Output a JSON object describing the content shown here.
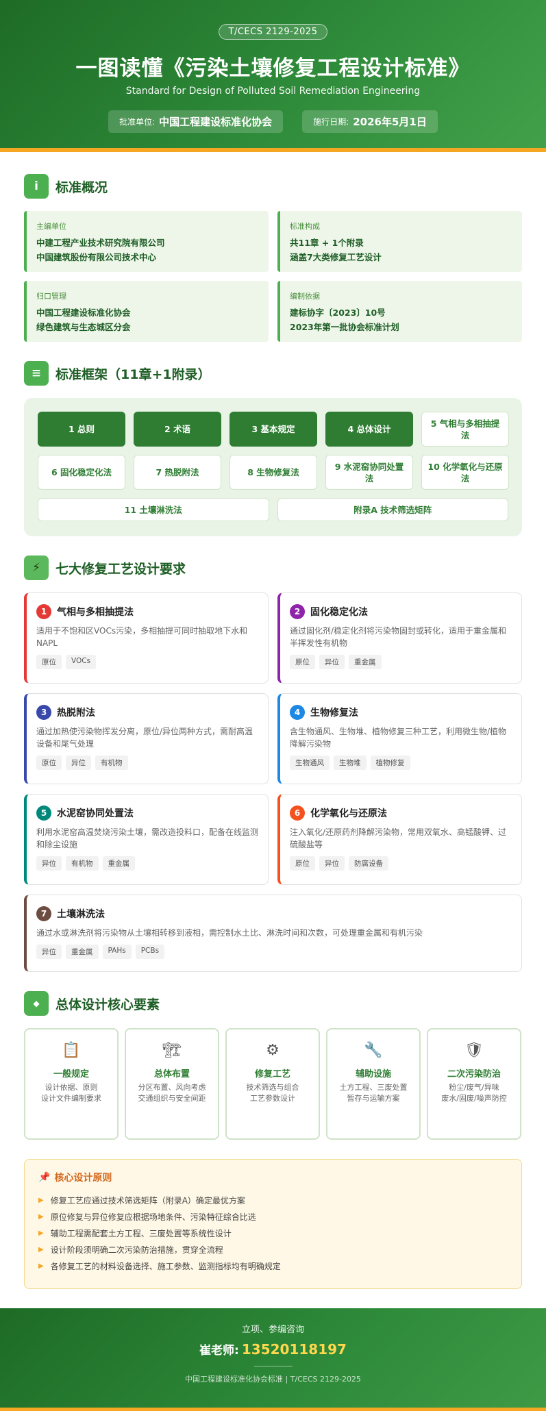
{
  "header": {
    "code": "T/CECS 2129-2025",
    "title": "一图读懂《污染土壤修复工程设计标准》",
    "subtitle_en": "Standard for Design of Polluted Soil Remediation Engineering",
    "approval_label": "批准单位:",
    "approval_value": "中国工程建设标准化协会",
    "date_label": "施行日期:",
    "date_value": "2026年5月1日"
  },
  "overview": {
    "icon": "i",
    "title": "标准概况",
    "cards": [
      {
        "label": "主编单位",
        "lines": [
          "中建工程产业技术研究院有限公司",
          "中国建筑股份有限公司技术中心"
        ]
      },
      {
        "label": "标准构成",
        "lines": [
          "共11章 + 1个附录",
          "涵盖7大类修复工艺设计"
        ]
      },
      {
        "label": "归口管理",
        "lines": [
          "中国工程建设标准化协会",
          "绿色建筑与生态城区分会"
        ]
      },
      {
        "label": "编制依据",
        "lines": [
          "建标协字〔2023〕10号",
          "2023年第一批协会标准计划"
        ]
      }
    ]
  },
  "framework": {
    "icon": "≡",
    "title": "标准框架（11章+1附录）",
    "chapters": [
      {
        "label": "1 总则",
        "style": "dark"
      },
      {
        "label": "2 术语",
        "style": "dark"
      },
      {
        "label": "3 基本规定",
        "style": "dark"
      },
      {
        "label": "4 总体设计",
        "style": "dark"
      },
      {
        "label": "5 气相与多相抽提法",
        "style": "light"
      },
      {
        "label": "6 固化稳定化法",
        "style": "light"
      },
      {
        "label": "7 热脱附法",
        "style": "light"
      },
      {
        "label": "8 生物修复法",
        "style": "light"
      },
      {
        "label": "9 水泥窑协同处置法",
        "style": "light"
      },
      {
        "label": "10 化学氧化与还原法",
        "style": "light"
      }
    ],
    "bottom": [
      "11 土壤淋洗法",
      "附录A 技术筛选矩阵"
    ]
  },
  "processes": {
    "icon": "⚡",
    "title": "七大修复工艺设计要求",
    "items": [
      {
        "num": "1",
        "title": "气相与多相抽提法",
        "desc": "适用于不饱和区VOCs污染，多相抽提可同时抽取地下水和NAPL",
        "tags": [
          "原位",
          "VOCs"
        ],
        "color": "#e53935"
      },
      {
        "num": "2",
        "title": "固化稳定化法",
        "desc": "通过固化剂/稳定化剂将污染物固封或转化，适用于重金属和半挥发性有机物",
        "tags": [
          "原位",
          "异位",
          "重金属"
        ],
        "color": "#8e24aa"
      },
      {
        "num": "3",
        "title": "热脱附法",
        "desc": "通过加热使污染物挥发分离，原位/异位两种方式，需耐高温设备和尾气处理",
        "tags": [
          "原位",
          "异位",
          "有机物"
        ],
        "color": "#3949ab"
      },
      {
        "num": "4",
        "title": "生物修复法",
        "desc": "含生物通风、生物堆、植物修复三种工艺，利用微生物/植物降解污染物",
        "tags": [
          "生物通风",
          "生物堆",
          "植物修复"
        ],
        "color": "#1e88e5"
      },
      {
        "num": "5",
        "title": "水泥窑协同处置法",
        "desc": "利用水泥窑高温焚烧污染土壤，需改造投料口，配备在线监测和除尘设施",
        "tags": [
          "异位",
          "有机物",
          "重金属"
        ],
        "color": "#00897b"
      },
      {
        "num": "6",
        "title": "化学氧化与还原法",
        "desc": "注入氧化/还原药剂降解污染物，常用双氧水、高锰酸钾、过硫酸盐等",
        "tags": [
          "原位",
          "异位",
          "防腐设备"
        ],
        "color": "#f4511e"
      },
      {
        "num": "7",
        "title": "土壤淋洗法",
        "desc": "通过水或淋洗剂将污染物从土壤相转移到液相，需控制水土比、淋洗时间和次数，可处理重金属和有机污染",
        "tags": [
          "异位",
          "重金属",
          "PAHs",
          "PCBs"
        ],
        "color": "#6d4c41"
      }
    ]
  },
  "elements": {
    "icon": "◆",
    "title": "总体设计核心要素",
    "items": [
      {
        "icon": "📋",
        "title": "一般规定",
        "lines": [
          "设计依据、原则",
          "设计文件编制要求"
        ]
      },
      {
        "icon": "🏗",
        "title": "总体布置",
        "lines": [
          "分区布置、风向考虑",
          "交通组织与安全间距"
        ]
      },
      {
        "icon": "⚙",
        "title": "修复工艺",
        "lines": [
          "技术筛选与组合",
          "工艺参数设计"
        ]
      },
      {
        "icon": "🔧",
        "title": "辅助设施",
        "lines": [
          "土方工程、三废处置",
          "暂存与运输方案"
        ]
      },
      {
        "icon": "🛡",
        "title": "二次污染防治",
        "lines": [
          "粉尘/废气/异味",
          "废水/固废/噪声防控"
        ]
      }
    ]
  },
  "principles": {
    "icon": "📌",
    "title": "核心设计原则",
    "items": [
      "修复工艺应通过技术筛选矩阵（附录A）确定最优方案",
      "原位修复与异位修复应根据场地条件、污染特征综合比选",
      "辅助工程需配套土方工程、三废处置等系统性设计",
      "设计阶段须明确二次污染防治措施，贯穿全流程",
      "各修复工艺的材料设备选择、施工参数、监测指标均有明确规定"
    ]
  },
  "footer": {
    "label": "立项、参编咨询",
    "contact_name": "崔老师:",
    "phone": "13520118197",
    "note": "中国工程建设标准化协会标准 | T/CECS 2129-2025"
  }
}
